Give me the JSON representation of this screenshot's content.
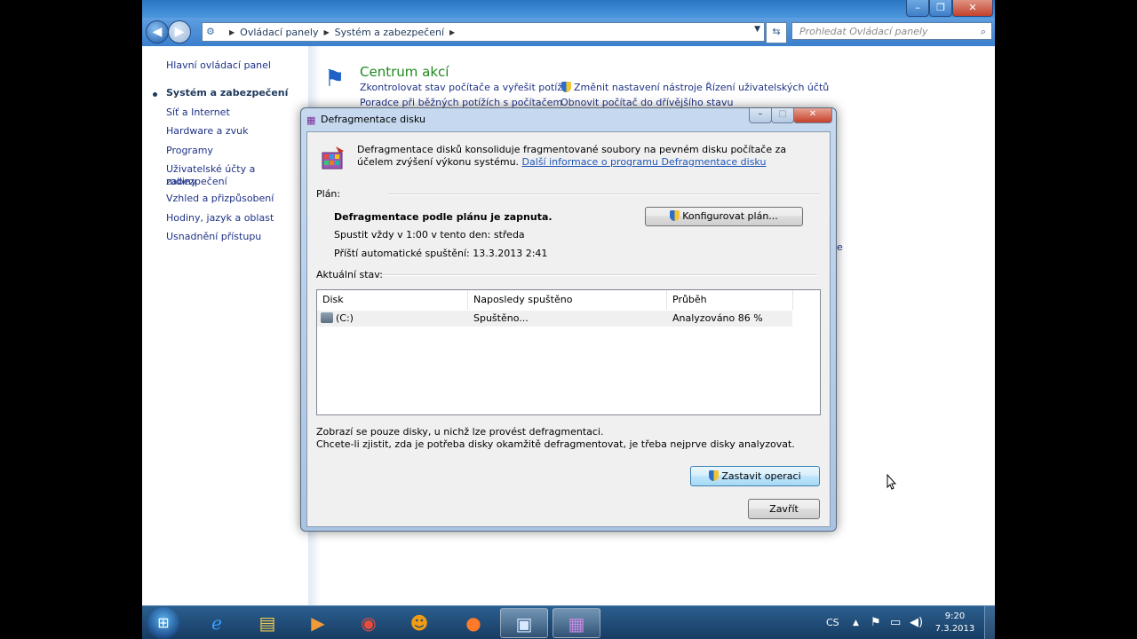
{
  "explorer": {
    "breadcrumb": [
      "Ovládací panely",
      "Systém a zabezpečení"
    ],
    "search_placeholder": "Prohledat Ovládací panely",
    "window_controls": {
      "minimize": "–",
      "maximize": "❐",
      "close": "✕"
    }
  },
  "sidebar": {
    "items": [
      {
        "label": "Hlavní ovládací panel",
        "active": false
      },
      {
        "label": "Systém a zabezpečení",
        "active": true
      },
      {
        "label": "Síť a Internet",
        "active": false
      },
      {
        "label": "Hardware a zvuk",
        "active": false
      },
      {
        "label": "Programy",
        "active": false
      },
      {
        "label": "Uživatelské účty a zabezpečení",
        "label2": "rodiny",
        "active": false
      },
      {
        "label": "Vzhled a přizpůsobení",
        "active": false
      },
      {
        "label": "Hodiny, jazyk a oblast",
        "active": false
      },
      {
        "label": "Usnadnění přístupu",
        "active": false
      }
    ]
  },
  "section": {
    "title": "Centrum akcí",
    "links": [
      "Zkontrolovat stav počítače a vyřešit potíže",
      "Změnit nastavení nástroje Řízení uživatelských účtů",
      "Poradce při běžných potížích s počítačem",
      "Obnovit počítač do dřívějšího stavu"
    ],
    "partial_link": "ce"
  },
  "dialog": {
    "title": "Defragmentace disku",
    "description": "Defragmentace disků konsoliduje fragmentované soubory na pevném disku počítače za účelem zvýšení výkonu systému.",
    "info_link": "Další informace o programu Defragmentace disku",
    "schedule": {
      "label": "Plán:",
      "status": "Defragmentace podle plánu je zapnuta.",
      "run": "Spustit vždy v 1:00 v tento den: středa",
      "next": "Příští automatické spuštění: 13.3.2013 2:41",
      "configure_button": "Konfigurovat plán..."
    },
    "current": {
      "label": "Aktuální stav:",
      "columns": [
        "Disk",
        "Naposledy spuštěno",
        "Průběh"
      ],
      "rows": [
        {
          "disk": "(C:)",
          "last_run": "Spuštěno...",
          "progress": "Analyzováno 86 %"
        }
      ]
    },
    "notes": [
      "Zobrazí se pouze disky, u nichž lze provést defragmentaci.",
      "Chcete-li zjistit, zda je potřeba disky okamžitě defragmentovat, je třeba nejprve disky analyzovat."
    ],
    "stop_button": "Zastavit operaci",
    "close_button": "Zavřít"
  },
  "taskbar": {
    "language": "CS",
    "time": "9:20",
    "date": "7.3.2013"
  }
}
